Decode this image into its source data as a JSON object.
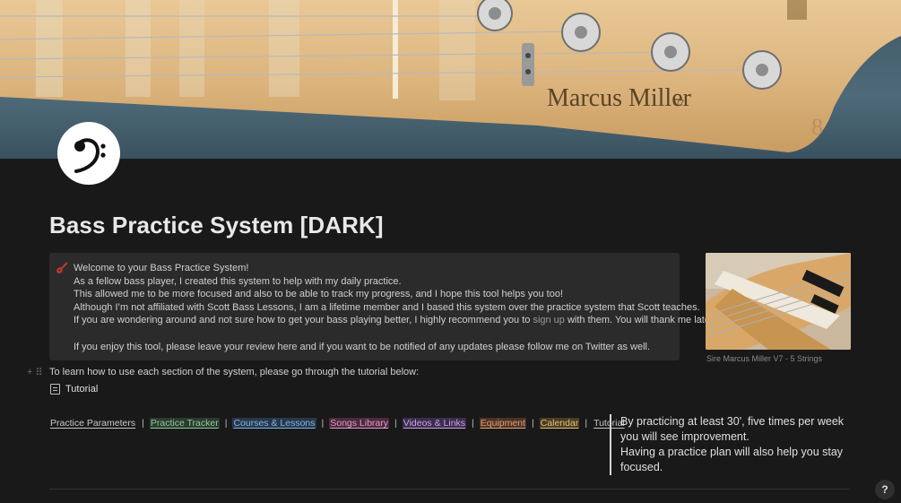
{
  "cover": {
    "brand": "Marcus Miller",
    "model": "V7"
  },
  "page": {
    "title": "Bass Practice System [DARK]",
    "icon": "bass-clef-icon"
  },
  "callout": {
    "icon": "guitar-icon",
    "lines": [
      "Welcome to your Bass Practice System!",
      "As a fellow bass player, I created this system to help with my daily practice.",
      "This allowed me to be more focused and also to be able to track my progress, and I hope this tool helps you too!",
      "Although I’m not affiliated with Scott Bass Lessons, I am a lifetime member and I based this system over the practice system that Scott teaches."
    ],
    "line5_before": "If you are wondering around and not sure how to get your bass playing better, I highly recommend you to",
    "line5_link": "sign up",
    "line5_after": "with them. You will thank me later.",
    "line6": "If you enjoy this tool, please leave your review here and if you want to be notified of any updates please follow me on Twitter as well."
  },
  "image": {
    "caption": "Sire Marcus Miller V7 - 5 Strings"
  },
  "learn_text": "To learn how to use each section of the system, please go through the tutorial below:",
  "tutorial_page": {
    "label": "Tutorial",
    "icon": "document-icon"
  },
  "nav": [
    {
      "label": "Practice Parameters",
      "color": "#c8c8c8",
      "bg": "transparent"
    },
    {
      "label": "Practice Tracker",
      "color": "#8fc79a",
      "bg": "#2c3a2f"
    },
    {
      "label": "Courses & Lessons",
      "color": "#7fb3e6",
      "bg": "#28384a"
    },
    {
      "label": "Songs Library",
      "color": "#e29bc4",
      "bg": "#4a2a3c"
    },
    {
      "label": "Videos & Links",
      "color": "#c6a2e8",
      "bg": "#3b2d4c"
    },
    {
      "label": "Equipment",
      "color": "#e6a07a",
      "bg": "#4a3326"
    },
    {
      "label": "Calendar",
      "color": "#e0c07a",
      "bg": "#4a3d22"
    },
    {
      "label": "Tutorial",
      "color": "#c8c8c8",
      "bg": "transparent"
    }
  ],
  "quote": {
    "line1": "By practicing at least 30', five times per week you will see improvement.",
    "line2": "Having a practice plan will also help you stay focused."
  },
  "help_label": "?"
}
